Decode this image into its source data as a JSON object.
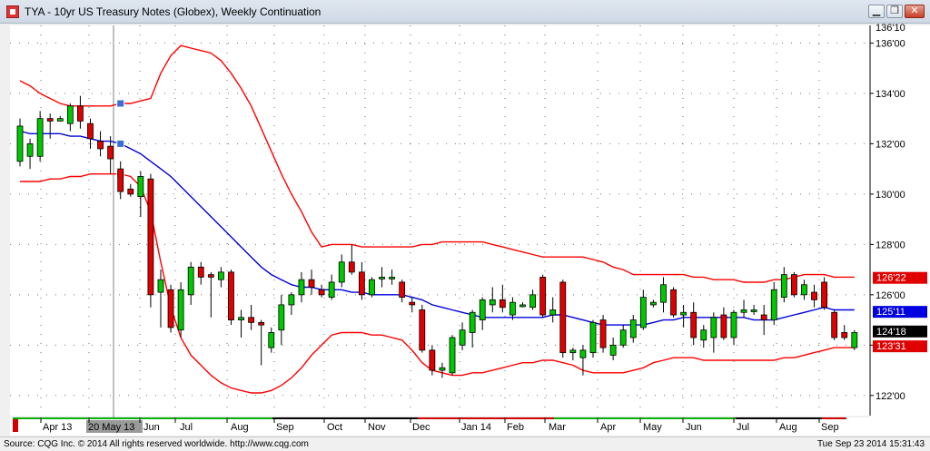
{
  "window": {
    "title": "TYA - 10yr US Treasury Notes (Globex), Weekly Continuation",
    "minimize_label": "▁",
    "restore_label": "❐",
    "close_label": "✕"
  },
  "status": {
    "source": "Source: CQG Inc. © 2014 All rights reserved worldwide. http://www.cqg.com",
    "timestamp": "Tue Sep 23 2014 15:31:43"
  },
  "chart_data": {
    "type": "candlestick",
    "instrument": "TYA - 10yr US Treasury Notes (Globex), Weekly Continuation",
    "y_unit": "points (fractional 32nds)",
    "ylim": [
      121.2,
      136.7
    ],
    "y_ticks": [
      122,
      124,
      126,
      128,
      130,
      132,
      134,
      136
    ],
    "y_tick_labels": [
      "122'00",
      "124'00",
      "126'00",
      "128'00",
      "130'00",
      "132'00",
      "134'00",
      "136'00"
    ],
    "top_partial_label": "136'10",
    "x_month_labels": [
      "Apr 13",
      "20 May 13",
      "Jun",
      "Jul",
      "Aug",
      "Sep",
      "Oct",
      "Nov",
      "Dec",
      "Jan 14",
      "Feb",
      "Mar",
      "Apr",
      "May",
      "Jun",
      "Jul",
      "Aug",
      "Sep"
    ],
    "x_highlighted_label": "20 May 13",
    "grid": true,
    "colors": {
      "up": "#00c800",
      "down": "#e00000",
      "bands": "#ff0000",
      "ma": "#0000e0",
      "background": "#ffffff"
    },
    "bars": [
      {
        "week": 0,
        "open": 131.3,
        "high": 133.0,
        "low": 131.1,
        "close": 132.7
      },
      {
        "week": 1,
        "open": 131.5,
        "high": 132.2,
        "low": 131.0,
        "close": 132.0
      },
      {
        "week": 2,
        "open": 131.5,
        "high": 133.3,
        "low": 131.3,
        "close": 133.0
      },
      {
        "week": 3,
        "open": 133.0,
        "high": 133.2,
        "low": 132.2,
        "close": 132.9
      },
      {
        "week": 4,
        "open": 132.9,
        "high": 133.1,
        "low": 132.9,
        "close": 133.0
      },
      {
        "week": 5,
        "open": 132.8,
        "high": 133.6,
        "low": 132.5,
        "close": 133.5
      },
      {
        "week": 6,
        "open": 133.5,
        "high": 133.9,
        "low": 132.6,
        "close": 132.9
      },
      {
        "week": 7,
        "open": 132.8,
        "high": 133.0,
        "low": 131.8,
        "close": 132.2
      },
      {
        "week": 8,
        "open": 132.1,
        "high": 132.5,
        "low": 131.5,
        "close": 131.8
      },
      {
        "week": 9,
        "open": 131.9,
        "high": 132.3,
        "low": 130.8,
        "close": 131.4
      },
      {
        "week": 10,
        "open": 131.0,
        "high": 131.3,
        "low": 129.8,
        "close": 130.1
      },
      {
        "week": 11,
        "open": 130.2,
        "high": 130.4,
        "low": 129.9,
        "close": 130.0
      },
      {
        "week": 12,
        "open": 129.9,
        "high": 130.9,
        "low": 129.1,
        "close": 130.7
      },
      {
        "week": 13,
        "open": 130.6,
        "high": 130.8,
        "low": 125.5,
        "close": 126.0
      },
      {
        "week": 14,
        "open": 126.1,
        "high": 127.0,
        "low": 124.7,
        "close": 126.6
      },
      {
        "week": 15,
        "open": 126.2,
        "high": 126.4,
        "low": 124.5,
        "close": 124.7
      },
      {
        "week": 16,
        "open": 124.6,
        "high": 126.5,
        "low": 124.3,
        "close": 126.2
      },
      {
        "week": 17,
        "open": 126.0,
        "high": 127.3,
        "low": 125.6,
        "close": 127.1
      },
      {
        "week": 18,
        "open": 127.1,
        "high": 127.3,
        "low": 126.4,
        "close": 126.7
      },
      {
        "week": 19,
        "open": 126.8,
        "high": 126.9,
        "low": 125.1,
        "close": 126.7
      },
      {
        "week": 20,
        "open": 126.6,
        "high": 127.1,
        "low": 126.3,
        "close": 126.9
      },
      {
        "week": 21,
        "open": 126.9,
        "high": 127.0,
        "low": 124.8,
        "close": 125.0
      },
      {
        "week": 22,
        "open": 125.0,
        "high": 125.4,
        "low": 124.3,
        "close": 125.1
      },
      {
        "week": 23,
        "open": 125.1,
        "high": 125.6,
        "low": 124.6,
        "close": 124.9
      },
      {
        "week": 24,
        "open": 124.9,
        "high": 125.0,
        "low": 123.2,
        "close": 124.8
      },
      {
        "week": 25,
        "open": 123.9,
        "high": 124.7,
        "low": 123.7,
        "close": 124.5
      },
      {
        "week": 26,
        "open": 124.6,
        "high": 126.0,
        "low": 124.0,
        "close": 125.6
      },
      {
        "week": 27,
        "open": 125.6,
        "high": 126.1,
        "low": 125.2,
        "close": 126.0
      },
      {
        "week": 28,
        "open": 126.0,
        "high": 126.9,
        "low": 125.7,
        "close": 126.6
      },
      {
        "week": 29,
        "open": 126.6,
        "high": 127.0,
        "low": 126.0,
        "close": 126.3
      },
      {
        "week": 30,
        "open": 126.2,
        "high": 126.4,
        "low": 125.9,
        "close": 126.0
      },
      {
        "week": 31,
        "open": 125.9,
        "high": 126.8,
        "low": 125.8,
        "close": 126.5
      },
      {
        "week": 32,
        "open": 126.5,
        "high": 127.6,
        "low": 126.3,
        "close": 127.3
      },
      {
        "week": 33,
        "open": 127.3,
        "high": 128.0,
        "low": 126.8,
        "close": 126.9
      },
      {
        "week": 34,
        "open": 126.9,
        "high": 127.3,
        "low": 125.8,
        "close": 126.0
      },
      {
        "week": 35,
        "open": 126.0,
        "high": 126.7,
        "low": 125.9,
        "close": 126.6
      },
      {
        "week": 36,
        "open": 126.7,
        "high": 127.1,
        "low": 126.3,
        "close": 126.7
      },
      {
        "week": 37,
        "open": 126.7,
        "high": 127.0,
        "low": 126.4,
        "close": 126.7
      },
      {
        "week": 38,
        "open": 126.5,
        "high": 126.6,
        "low": 125.7,
        "close": 125.9
      },
      {
        "week": 39,
        "open": 125.7,
        "high": 125.9,
        "low": 125.3,
        "close": 125.6
      },
      {
        "week": 40,
        "open": 125.4,
        "high": 125.6,
        "low": 123.7,
        "close": 123.8
      },
      {
        "week": 41,
        "open": 123.8,
        "high": 124.0,
        "low": 122.8,
        "close": 123.0
      },
      {
        "week": 42,
        "open": 123.0,
        "high": 123.3,
        "low": 122.7,
        "close": 123.1
      },
      {
        "week": 43,
        "open": 122.9,
        "high": 124.4,
        "low": 122.8,
        "close": 124.3
      },
      {
        "week": 44,
        "open": 124.0,
        "high": 124.9,
        "low": 123.8,
        "close": 124.6
      },
      {
        "week": 45,
        "open": 124.5,
        "high": 125.4,
        "low": 123.9,
        "close": 125.3
      },
      {
        "week": 46,
        "open": 125.0,
        "high": 125.9,
        "low": 124.6,
        "close": 125.8
      },
      {
        "week": 47,
        "open": 125.6,
        "high": 126.3,
        "low": 125.3,
        "close": 125.8
      },
      {
        "week": 48,
        "open": 125.8,
        "high": 126.4,
        "low": 125.3,
        "close": 125.5
      },
      {
        "week": 49,
        "open": 125.2,
        "high": 125.9,
        "low": 125.0,
        "close": 125.7
      },
      {
        "week": 50,
        "open": 125.6,
        "high": 125.7,
        "low": 125.5,
        "close": 125.6
      },
      {
        "week": 51,
        "open": 125.5,
        "high": 126.2,
        "low": 125.4,
        "close": 126.0
      },
      {
        "week": 52,
        "open": 126.7,
        "high": 126.8,
        "low": 125.1,
        "close": 125.2
      },
      {
        "week": 53,
        "open": 125.2,
        "high": 125.9,
        "low": 124.9,
        "close": 125.4
      },
      {
        "week": 54,
        "open": 126.5,
        "high": 126.6,
        "low": 123.5,
        "close": 123.7
      },
      {
        "week": 55,
        "open": 123.7,
        "high": 123.9,
        "low": 123.4,
        "close": 123.8
      },
      {
        "week": 56,
        "open": 123.5,
        "high": 124.0,
        "low": 122.8,
        "close": 123.8
      },
      {
        "week": 57,
        "open": 123.7,
        "high": 125.0,
        "low": 123.5,
        "close": 124.9
      },
      {
        "week": 58,
        "open": 125.0,
        "high": 125.2,
        "low": 123.7,
        "close": 123.9
      },
      {
        "week": 59,
        "open": 123.6,
        "high": 124.3,
        "low": 123.4,
        "close": 124.0
      },
      {
        "week": 60,
        "open": 124.0,
        "high": 124.8,
        "low": 123.9,
        "close": 124.6
      },
      {
        "week": 61,
        "open": 124.3,
        "high": 125.2,
        "low": 124.1,
        "close": 125.0
      },
      {
        "week": 62,
        "open": 124.7,
        "high": 126.2,
        "low": 124.6,
        "close": 125.9
      },
      {
        "week": 63,
        "open": 125.6,
        "high": 125.8,
        "low": 125.5,
        "close": 125.7
      },
      {
        "week": 64,
        "open": 125.7,
        "high": 126.7,
        "low": 125.3,
        "close": 126.4
      },
      {
        "week": 65,
        "open": 126.2,
        "high": 126.3,
        "low": 125.1,
        "close": 125.2
      },
      {
        "week": 66,
        "open": 125.2,
        "high": 125.6,
        "low": 124.7,
        "close": 125.3
      },
      {
        "week": 67,
        "open": 125.3,
        "high": 125.7,
        "low": 124.0,
        "close": 124.3
      },
      {
        "week": 68,
        "open": 124.2,
        "high": 124.8,
        "low": 123.9,
        "close": 124.6
      },
      {
        "week": 69,
        "open": 124.3,
        "high": 125.3,
        "low": 123.7,
        "close": 125.1
      },
      {
        "week": 70,
        "open": 125.2,
        "high": 125.5,
        "low": 124.2,
        "close": 124.3
      },
      {
        "week": 71,
        "open": 124.3,
        "high": 125.4,
        "low": 124.0,
        "close": 125.3
      },
      {
        "week": 72,
        "open": 125.3,
        "high": 125.8,
        "low": 125.1,
        "close": 125.4
      },
      {
        "week": 73,
        "open": 125.4,
        "high": 125.6,
        "low": 125.2,
        "close": 125.4
      },
      {
        "week": 74,
        "open": 125.2,
        "high": 125.6,
        "low": 124.4,
        "close": 125.0
      },
      {
        "week": 75,
        "open": 125.0,
        "high": 126.5,
        "low": 124.8,
        "close": 126.2
      },
      {
        "week": 76,
        "open": 125.9,
        "high": 127.1,
        "low": 125.7,
        "close": 126.8
      },
      {
        "week": 77,
        "open": 126.8,
        "high": 126.9,
        "low": 125.9,
        "close": 126.0
      },
      {
        "week": 78,
        "open": 126.0,
        "high": 126.6,
        "low": 125.8,
        "close": 126.4
      },
      {
        "week": 79,
        "open": 126.1,
        "high": 126.4,
        "low": 125.5,
        "close": 125.8
      },
      {
        "week": 80,
        "open": 126.5,
        "high": 126.7,
        "low": 125.4,
        "close": 125.5
      },
      {
        "week": 81,
        "open": 125.3,
        "high": 125.4,
        "low": 124.2,
        "close": 124.3
      },
      {
        "week": 82,
        "open": 124.5,
        "high": 124.8,
        "low": 124.2,
        "close": 124.3
      },
      {
        "week": 83,
        "open": 123.9,
        "high": 124.6,
        "low": 123.8,
        "close": 124.5
      }
    ],
    "upper_band": [
      134.5,
      134.3,
      134.0,
      133.8,
      133.6,
      133.5,
      133.5,
      133.5,
      133.5,
      133.5,
      133.6,
      133.6,
      133.7,
      133.8,
      134.8,
      135.5,
      135.9,
      135.8,
      135.7,
      135.6,
      135.3,
      134.8,
      134.2,
      133.5,
      132.6,
      131.7,
      130.8,
      130.0,
      129.3,
      128.5,
      127.9,
      128.0,
      128.0,
      128.0,
      127.9,
      127.9,
      127.9,
      127.9,
      127.9,
      127.9,
      128.0,
      128.0,
      128.1,
      128.1,
      128.1,
      128.1,
      128.1,
      128.0,
      127.9,
      127.8,
      127.7,
      127.6,
      127.5,
      127.5,
      127.5,
      127.5,
      127.5,
      127.4,
      127.3,
      127.1,
      127.0,
      126.8,
      126.8,
      126.8,
      126.8,
      126.8,
      126.8,
      126.7,
      126.7,
      126.6,
      126.6,
      126.6,
      126.5,
      126.5,
      126.5,
      126.6,
      126.6,
      126.7,
      126.8,
      126.8,
      126.8,
      126.7,
      126.7,
      126.7
    ],
    "moving_average": [
      132.5,
      132.4,
      132.4,
      132.4,
      132.4,
      132.3,
      132.3,
      132.2,
      132.1,
      132.1,
      132.0,
      131.8,
      131.6,
      131.3,
      131.0,
      130.7,
      130.3,
      129.9,
      129.5,
      129.1,
      128.7,
      128.3,
      127.9,
      127.5,
      127.1,
      126.8,
      126.6,
      126.4,
      126.3,
      126.3,
      126.2,
      126.2,
      126.2,
      126.1,
      126.1,
      126.0,
      126.0,
      126.0,
      126.0,
      125.9,
      125.8,
      125.6,
      125.5,
      125.4,
      125.3,
      125.2,
      125.1,
      125.1,
      125.1,
      125.1,
      125.1,
      125.1,
      125.1,
      125.2,
      125.2,
      125.1,
      125.0,
      124.9,
      124.8,
      124.8,
      124.8,
      124.8,
      124.8,
      124.9,
      125.0,
      125.0,
      125.1,
      125.1,
      125.1,
      125.1,
      125.1,
      125.1,
      125.1,
      125.0,
      125.0,
      125.0,
      125.1,
      125.2,
      125.3,
      125.4,
      125.5,
      125.4,
      125.4,
      125.4
    ],
    "lower_band": [
      130.5,
      130.5,
      130.5,
      130.6,
      130.6,
      130.7,
      130.7,
      130.8,
      130.8,
      130.8,
      130.8,
      130.7,
      130.3,
      129.3,
      127.3,
      125.5,
      124.3,
      123.6,
      123.2,
      122.8,
      122.5,
      122.3,
      122.2,
      122.1,
      122.1,
      122.2,
      122.4,
      122.7,
      123.1,
      123.6,
      124.0,
      124.4,
      124.5,
      124.5,
      124.5,
      124.4,
      124.4,
      124.3,
      124.2,
      123.8,
      123.3,
      123.0,
      122.9,
      122.8,
      122.8,
      122.9,
      122.9,
      123.0,
      123.1,
      123.2,
      123.3,
      123.3,
      123.4,
      123.4,
      123.3,
      123.2,
      123.0,
      122.9,
      122.9,
      122.9,
      122.9,
      123.0,
      123.1,
      123.3,
      123.4,
      123.5,
      123.5,
      123.5,
      123.4,
      123.4,
      123.4,
      123.4,
      123.4,
      123.4,
      123.4,
      123.4,
      123.5,
      123.5,
      123.6,
      123.7,
      123.8,
      123.9,
      123.9,
      123.9
    ],
    "price_tags": [
      {
        "label": "126'22",
        "value": 126.69,
        "series": "upper_band"
      },
      {
        "label": "125'11",
        "value": 125.34,
        "series": "moving_average"
      },
      {
        "label": "124'18",
        "value": 124.56,
        "series": "last_price"
      },
      {
        "label": "123'31",
        "value": 123.97,
        "series": "lower_band"
      }
    ]
  }
}
